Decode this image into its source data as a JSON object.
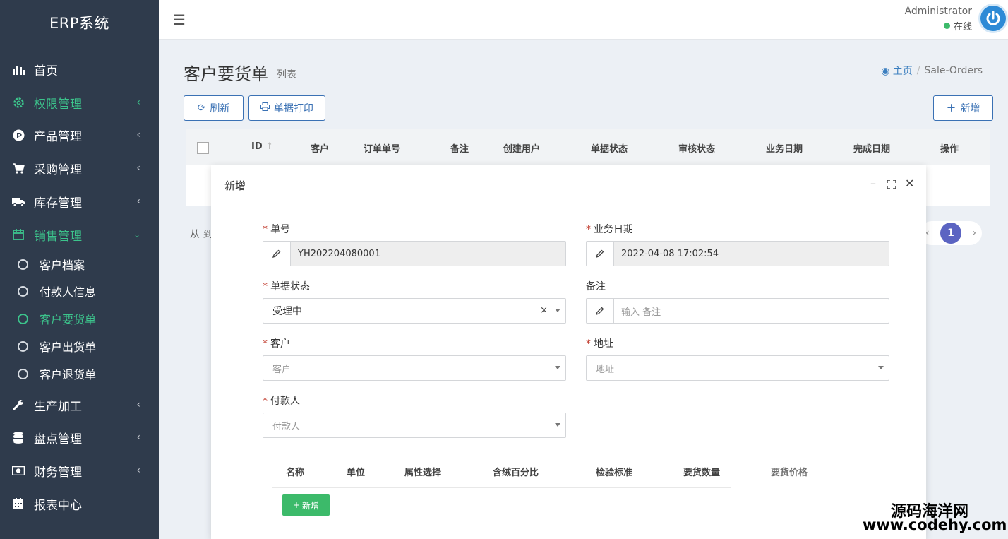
{
  "app": {
    "brand": "ERP系统"
  },
  "sidebar": {
    "items": [
      {
        "label": "首页",
        "icon": "bar-chart-icon"
      },
      {
        "label": "权限管理",
        "icon": "gear-icon",
        "active": true
      },
      {
        "label": "产品管理",
        "icon": "product-p-icon"
      },
      {
        "label": "采购管理",
        "icon": "cart-icon"
      },
      {
        "label": "库存管理",
        "icon": "truck-icon"
      },
      {
        "label": "销售管理",
        "icon": "calendar-icon",
        "active": true,
        "expanded": true
      },
      {
        "label": "生产加工",
        "icon": "wrench-icon"
      },
      {
        "label": "盘点管理",
        "icon": "database-icon"
      },
      {
        "label": "财务管理",
        "icon": "money-icon"
      },
      {
        "label": "报表中心",
        "icon": "calendar-grid-icon"
      }
    ],
    "sales_sub": [
      "客户档案",
      "付款人信息",
      "客户要货单",
      "客户出货单",
      "客户退货单"
    ],
    "active_sub": "客户要货单",
    "accent_color": "#3cc48c"
  },
  "header": {
    "user_name": "Administrator",
    "user_status": "在线"
  },
  "page": {
    "title": "客户要货单",
    "subtitle": "列表",
    "breadcrumb": {
      "home": "主页",
      "sep": "/",
      "current": "Sale-Orders"
    },
    "toolbar": {
      "refresh": "刷新",
      "print": "单据打印",
      "add": "新增"
    },
    "table": {
      "columns": [
        "ID",
        "客户",
        "订单单号",
        "备注",
        "创建用户",
        "单据状态",
        "审核状态",
        "业务日期",
        "完成日期",
        "操作"
      ]
    },
    "footer_text": "从 到",
    "pagination": {
      "current": "1"
    }
  },
  "modal": {
    "title": "新增",
    "fields": {
      "order_no": {
        "label": "单号",
        "value": "YH202204080001"
      },
      "biz_date": {
        "label": "业务日期",
        "value": "2022-04-08 17:02:54"
      },
      "status": {
        "label": "单据状态",
        "value": "受理中"
      },
      "remark": {
        "label": "备注",
        "placeholder": "输入 备注"
      },
      "customer": {
        "label": "客户",
        "placeholder": "客户"
      },
      "address": {
        "label": "地址",
        "placeholder": "地址"
      },
      "payer": {
        "label": "付款人",
        "placeholder": "付款人"
      }
    },
    "detail_columns": [
      "名称",
      "单位",
      "属性选择",
      "含绒百分比",
      "检验标准",
      "要货数量",
      "要货价格"
    ],
    "add_row_label": "新增"
  },
  "watermark": {
    "line1": "源码海洋网",
    "line2": "www.codehy.com"
  }
}
